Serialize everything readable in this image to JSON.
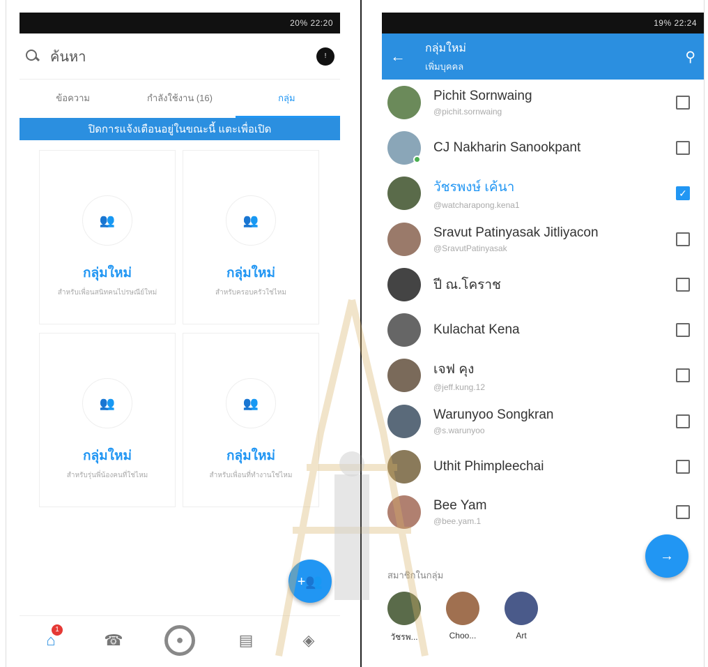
{
  "left": {
    "status": "20% 22:20",
    "search_placeholder": "ค้นหา",
    "profile_badge": "!",
    "tabs": [
      {
        "label": "ข้อความ"
      },
      {
        "label": "กำลังใช้งาน (16)"
      },
      {
        "label": "กลุ่ม"
      }
    ],
    "banner": "ปิดการแจ้งเตือนอยู่ในขณะนี้ แตะเพื่อเปิด",
    "cards": [
      {
        "title": "กลุ่มใหม่",
        "subtitle": "สำหรับเพื่อนสนิทคนไปรษณีย์ใหม่"
      },
      {
        "title": "กลุ่มใหม่",
        "subtitle": "สำหรับครอบครัวใช่ไหม"
      },
      {
        "title": "กลุ่มใหม่",
        "subtitle": "สำหรับรุ่นพี่น้องคนที่ใช่ไหม"
      },
      {
        "title": "กลุ่มใหม่",
        "subtitle": "สำหรับเพื่อนที่ทำงานใช่ไหม"
      }
    ],
    "home_badge": "1"
  },
  "right": {
    "status": "19% 22:24",
    "title": "กลุ่มใหม่",
    "subtitle": "เพิ่มบุคคล",
    "contacts": [
      {
        "name": "Pichit Sornwaing",
        "handle": "@pichit.sornwaing",
        "checked": false,
        "color": "#6b8a5a"
      },
      {
        "name": "CJ Nakharin Sanookpant",
        "handle": "",
        "checked": false,
        "color": "#8aa6b8"
      },
      {
        "name": "วัชรพงษ์ เค้นา",
        "handle": "@watcharapong.kena1",
        "checked": true,
        "color": "#5a6b4a"
      },
      {
        "name": "Sravut Patinyasak Jitliyacon",
        "handle": "@SravutPatinyasak",
        "checked": false,
        "color": "#9a7a6a"
      },
      {
        "name": "ปี ณ.โคราช",
        "handle": "",
        "checked": false,
        "color": "#444444"
      },
      {
        "name": "Kulachat Kena",
        "handle": "",
        "checked": false,
        "color": "#666666"
      },
      {
        "name": "เจฟ คุง",
        "handle": "@jeff.kung.12",
        "checked": false,
        "color": "#7a6a5a"
      },
      {
        "name": "Warunyoo Songkran",
        "handle": "@s.warunyoo",
        "checked": false,
        "color": "#5a6a7a"
      },
      {
        "name": "Uthit Phimpleechai",
        "handle": "",
        "checked": false,
        "color": "#8a7a5a"
      },
      {
        "name": "Bee Yam",
        "handle": "@bee.yam.1",
        "checked": false,
        "color": "#b08070"
      }
    ],
    "members_title": "สมาชิกในกลุ่ม",
    "members": [
      {
        "label": "วัชรพ...",
        "color": "#5a6b4a"
      },
      {
        "label": "Choo...",
        "color": "#a07050"
      },
      {
        "label": "Art",
        "color": "#4a5a8a"
      }
    ]
  }
}
